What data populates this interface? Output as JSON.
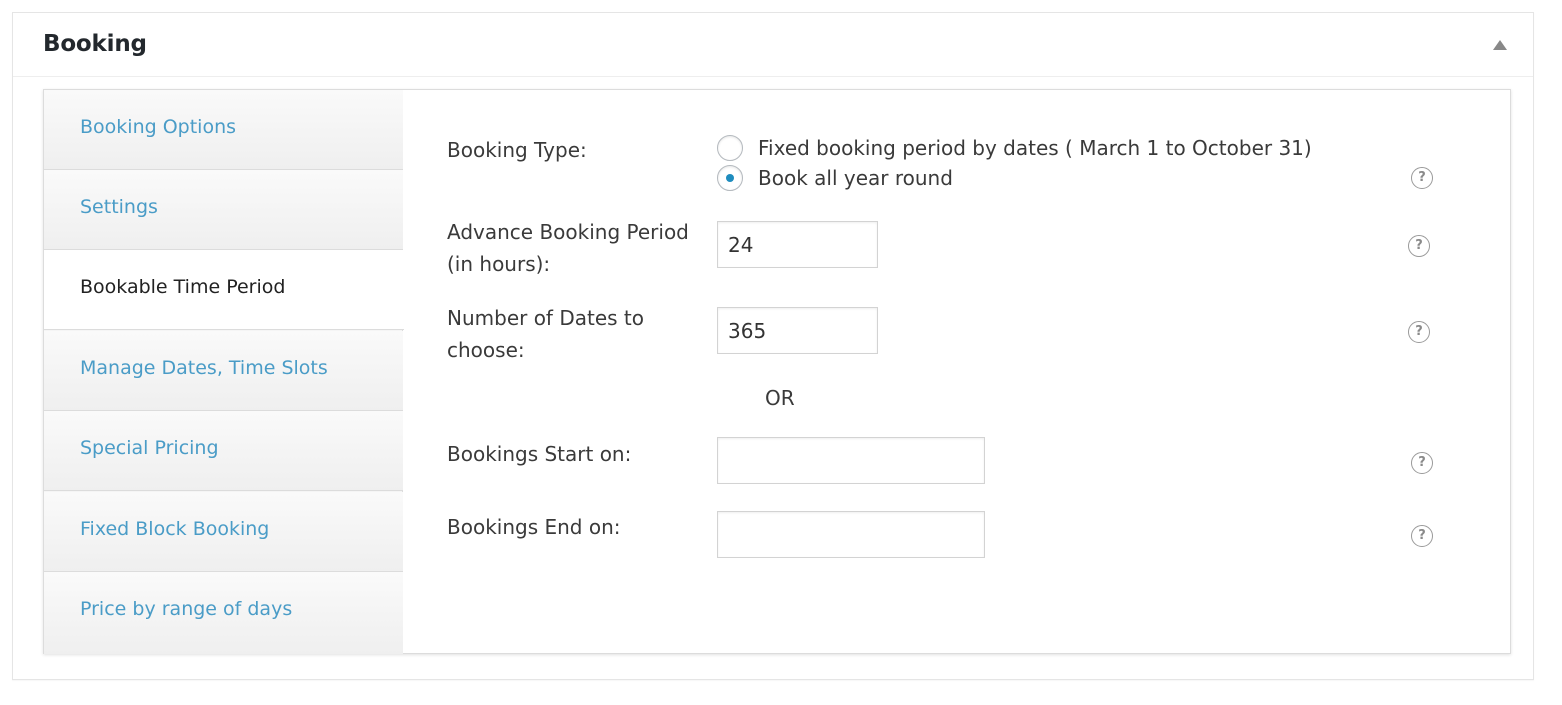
{
  "metabox": {
    "title": "Booking",
    "toggle_icon": "triangle-up-icon"
  },
  "tabs": [
    {
      "label": "Booking Options",
      "active": false
    },
    {
      "label": "Settings",
      "active": false
    },
    {
      "label": "Bookable Time Period",
      "active": true
    },
    {
      "label": "Manage Dates, Time Slots",
      "active": false
    },
    {
      "label": "Special Pricing",
      "active": false
    },
    {
      "label": "Fixed Block Booking",
      "active": false
    },
    {
      "label": "Price by range of days",
      "active": false
    }
  ],
  "form": {
    "booking_type": {
      "label": "Booking Type:",
      "options": [
        {
          "label": "Fixed booking period by dates ( March 1 to October 31)",
          "checked": false
        },
        {
          "label": "Book all year round",
          "checked": true
        }
      ]
    },
    "advance_period": {
      "label_line1": "Advance Booking Period",
      "label_line2": "(in hours):",
      "value": "24"
    },
    "number_of_dates": {
      "label_line1": "Number of Dates to",
      "label_line2": "choose:",
      "value": "365"
    },
    "or_text": "OR",
    "start_on": {
      "label": "Bookings Start on:",
      "value": ""
    },
    "end_on": {
      "label": "Bookings End on:",
      "value": ""
    },
    "help_icon_glyph": "?"
  },
  "colors": {
    "tab_link": "#4a9cc7",
    "tab_active_text": "#222222",
    "radio_checked": "#1e8cbe"
  }
}
